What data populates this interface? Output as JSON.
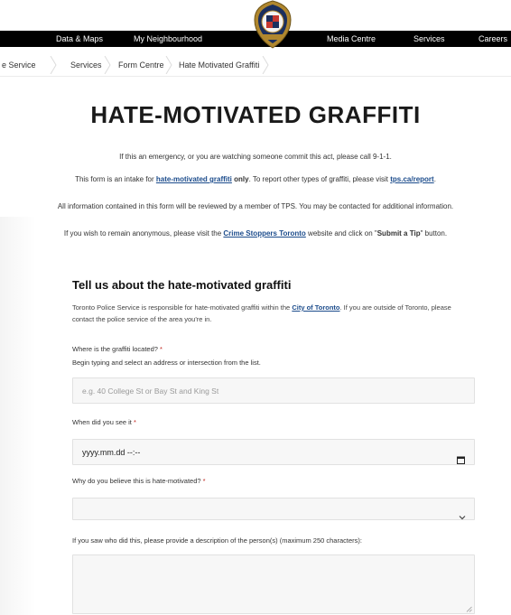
{
  "nav": {
    "items": [
      "Data & Maps",
      "My Neighbourhood",
      "Media Centre",
      "Services",
      "Careers"
    ]
  },
  "breadcrumb": [
    "e Service",
    "Services",
    "Form Centre",
    "Hate Motivated Graffiti"
  ],
  "page": {
    "title": "HATE-MOTIVATED GRAFFITI"
  },
  "intro": {
    "emergency": "If this an emergency, or you are watching someone commit this act, please call 9-1-1.",
    "intake_before": "This form is an intake for ",
    "intake_link": "hate-motivated graffiti",
    "intake_bold": " only",
    "intake_after": ". To report other types of graffiti, please visit ",
    "intake_link2": "tps.ca/report",
    "intake_end": ".",
    "review": "All information contained in this form will be reviewed by a member of TPS. You may be contacted for additional information.",
    "anon_before": "If you wish to remain anonymous, please visit the ",
    "anon_link": "Crime Stoppers Toronto",
    "anon_middle": " website and click on \"",
    "anon_bold": "Submit a Tip",
    "anon_after": "\" button."
  },
  "section": {
    "title": "Tell us about the hate-motivated graffiti",
    "desc_before": "Toronto Police Service is responsible for hate-motivated graffiti within the ",
    "desc_link": "City of Toronto",
    "desc_after": ". If you are outside of Toronto, please contact the police service of the area you're in."
  },
  "form": {
    "location_label": "Where is the graffiti located?",
    "location_hint": "Begin typing and select an address or intersection from the list.",
    "location_placeholder": "e.g. 40 College St or Bay St and King St",
    "date_label": "When did you see it",
    "date_value": "yyyy.mm.dd --:--",
    "reason_label": "Why do you believe this is hate-motivated?",
    "reason_value": "",
    "description_label": "If you saw who did this, please provide a description of the person(s) (maximum 250 characters):",
    "required_marker": "*"
  },
  "colors": {
    "nav_bg": "#000000",
    "link": "#1c4c8c",
    "required": "#c0271f",
    "input_bg": "#f7f7f7"
  },
  "icons": {
    "crest": "toronto-police-crest-icon",
    "calendar": "calendar-icon",
    "chevron": "chevron-down-icon",
    "resize": "resize-handle-icon"
  }
}
